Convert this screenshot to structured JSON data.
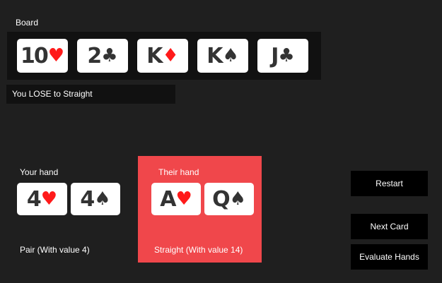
{
  "board": {
    "label": "Board",
    "cards": [
      {
        "rank": "10",
        "suit": "♥",
        "color": "red"
      },
      {
        "rank": "2",
        "suit": "♣",
        "color": "black"
      },
      {
        "rank": "K",
        "suit": "♦",
        "color": "red"
      },
      {
        "rank": "K",
        "suit": "♠",
        "color": "black"
      },
      {
        "rank": "J",
        "suit": "♣",
        "color": "black"
      }
    ]
  },
  "status": {
    "text": "You LOSE to Straight"
  },
  "your_hand": {
    "label": "Your hand",
    "cards": [
      {
        "rank": "4",
        "suit": "♥",
        "color": "red"
      },
      {
        "rank": "4",
        "suit": "♠",
        "color": "black"
      }
    ],
    "result": "Pair (With value 4)"
  },
  "their_hand": {
    "label": "Their hand",
    "cards": [
      {
        "rank": "A",
        "suit": "♥",
        "color": "red"
      },
      {
        "rank": "Q",
        "suit": "♠",
        "color": "black"
      }
    ],
    "result": "Straight (With value 14)"
  },
  "buttons": {
    "restart": "Restart",
    "next_card": "Next Card",
    "evaluate_hands": "Evaluate Hands"
  },
  "colors": {
    "background": "#1f1f1f",
    "panel_dark": "#111111",
    "winner_panel": "#f0474b",
    "suit_red": "#ff1a1a",
    "suit_black": "#333333",
    "button_bg": "#000000"
  }
}
